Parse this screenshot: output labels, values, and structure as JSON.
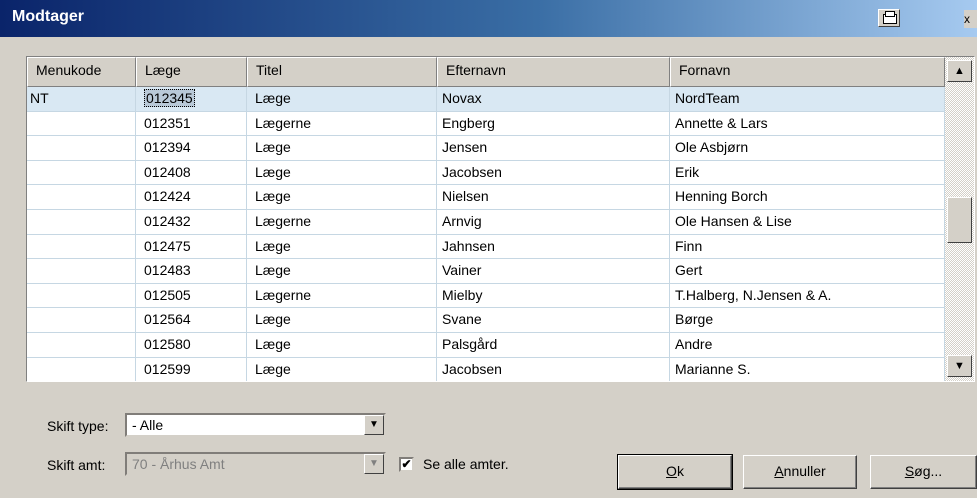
{
  "window": {
    "title": "Modtager",
    "close_glyph": "x"
  },
  "grid": {
    "columns": [
      "Menukode",
      "Læge",
      "Titel",
      "Efternavn",
      "Fornavn"
    ],
    "rows": [
      [
        "NT",
        "012345",
        "Læge",
        "Novax",
        "NordTeam"
      ],
      [
        "",
        "012351",
        "Lægerne",
        "Engberg",
        "Annette & Lars"
      ],
      [
        "",
        "012394",
        "Læge",
        "Jensen",
        "Ole Asbjørn"
      ],
      [
        "",
        "012408",
        "Læge",
        "Jacobsen",
        "Erik"
      ],
      [
        "",
        "012424",
        "Læge",
        "Nielsen",
        "Henning Borch"
      ],
      [
        "",
        "012432",
        "Lægerne",
        "Arnvig",
        "Ole Hansen & Lise"
      ],
      [
        "",
        "012475",
        "Læge",
        "Jahnsen",
        "Finn"
      ],
      [
        "",
        "012483",
        "Læge",
        "Vainer",
        "Gert"
      ],
      [
        "",
        "012505",
        "Lægerne",
        "Mielby",
        "T.Halberg, N.Jensen & A."
      ],
      [
        "",
        "012564",
        "Læge",
        "Svane",
        "Børge"
      ],
      [
        "",
        "012580",
        "Læge",
        "Palsgård",
        "Andre"
      ],
      [
        "",
        "012599",
        "Læge",
        "Jacobsen",
        "Marianne S."
      ]
    ],
    "selected_row": 0
  },
  "filters": {
    "type_label": "Skift type:",
    "type_value": "- Alle",
    "amt_label": "Skift amt:",
    "amt_value": "70 - Århus Amt",
    "show_all_label": "Se alle amter.",
    "show_all_checked": true
  },
  "buttons": {
    "ok": {
      "underlined": "O",
      "rest": "k"
    },
    "cancel": {
      "underlined": "A",
      "rest": "nnuller"
    },
    "search": {
      "underlined": "S",
      "rest": "øg..."
    }
  },
  "icons": {
    "print": "printer-icon",
    "close": "close-icon",
    "scroll_up": "arrow-up-icon",
    "scroll_down": "arrow-down-icon",
    "dropdown": "chevron-down-icon",
    "check": "checkmark-icon"
  }
}
